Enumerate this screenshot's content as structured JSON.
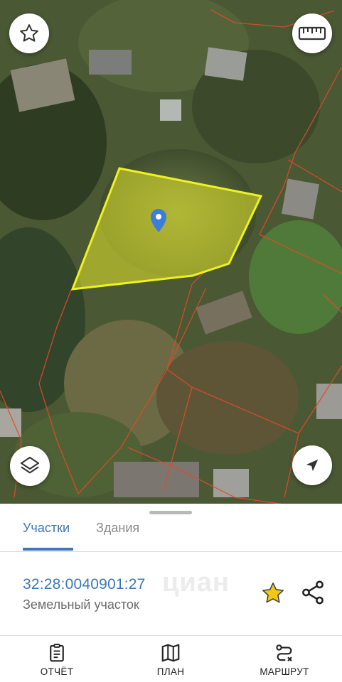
{
  "map": {
    "buttons": {
      "favorite_icon": "star-outline-icon",
      "ruler_icon": "ruler-icon",
      "layers_icon": "layers-icon",
      "locate_icon": "navigation-arrow-icon"
    },
    "selected_parcel_color": "#e8ea2a",
    "boundary_color": "#e24a2a",
    "pin_color": "#3b7dd8"
  },
  "sheet": {
    "tabs": [
      {
        "label": "Участки",
        "active": true
      },
      {
        "label": "Здания",
        "active": false
      }
    ],
    "parcel": {
      "cadastral_number": "32:28:0040901:27",
      "type": "Земельный участок",
      "watermark": "циан",
      "star_color": "#f2c812"
    },
    "nav": [
      {
        "label": "ОТЧЁТ",
        "icon": "clipboard-icon"
      },
      {
        "label": "ПЛАН",
        "icon": "map-icon"
      },
      {
        "label": "МАРШРУТ",
        "icon": "route-icon"
      }
    ]
  },
  "colors": {
    "accent": "#3d77b8",
    "muted_text": "#8a8a8a"
  }
}
